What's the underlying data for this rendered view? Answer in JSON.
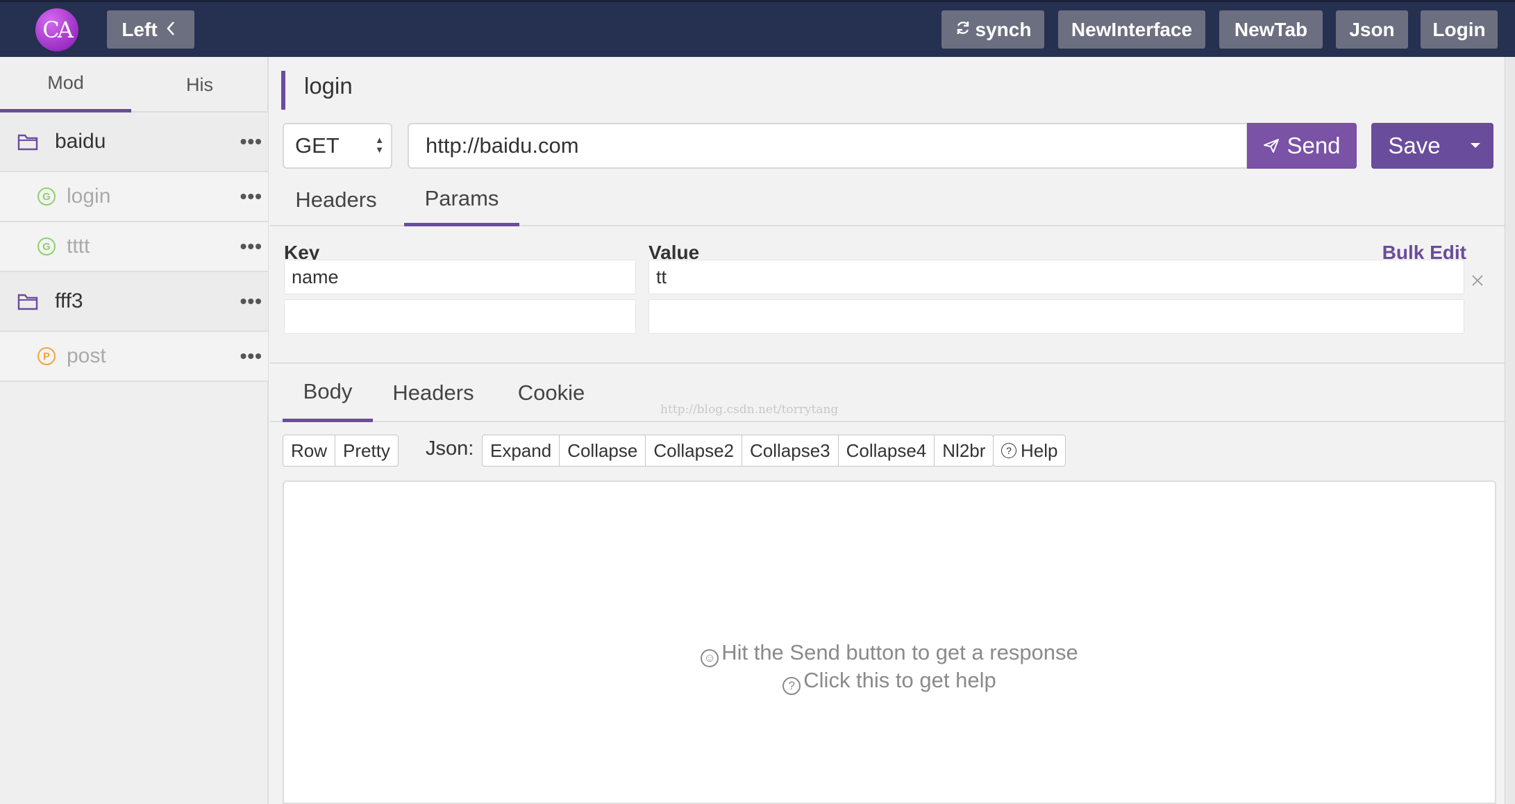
{
  "topbar": {
    "logo_text": "CA",
    "left_button": "Left",
    "buttons": {
      "synch": "synch",
      "new_interface": "NewInterface",
      "new_tab": "NewTab",
      "json": "Json",
      "login": "Login"
    }
  },
  "sidebar": {
    "tabs": [
      "Mod",
      "His"
    ],
    "active_tab": "Mod",
    "tree": {
      "folder1": {
        "name": "baidu"
      },
      "child1": {
        "name": "login",
        "method": "G"
      },
      "child2": {
        "name": "tttt",
        "method": "G"
      },
      "folder2": {
        "name": "fff3"
      },
      "child3": {
        "name": "post",
        "method": "P"
      }
    },
    "more_label": "•••"
  },
  "request": {
    "title": "login",
    "method": "GET",
    "url": "http://baidu.com",
    "send_label": "Send",
    "save_label": "Save",
    "tabs": [
      "Headers",
      "Params"
    ],
    "active_tab": "Params"
  },
  "params": {
    "key_header": "Key",
    "value_header": "Value",
    "bulk_edit": "Bulk Edit",
    "rows": [
      {
        "key": "name",
        "value": "tt"
      },
      {
        "key": "",
        "value": ""
      }
    ]
  },
  "response": {
    "tabs": [
      "Body",
      "Headers",
      "Cookie"
    ],
    "active_tab": "Body",
    "watermark": "http://blog.csdn.net/torrytang",
    "view_modes": [
      "Row",
      "Pretty"
    ],
    "json_label": "Json:",
    "json_actions": [
      "Expand",
      "Collapse",
      "Collapse2",
      "Collapse3",
      "Collapse4",
      "Nl2br"
    ],
    "help_label": "Help",
    "hint_send": "Hit the Send button to get a response",
    "hint_help": "Click this to get help"
  },
  "colors": {
    "topbar": "#263050",
    "accent": "#6a4c9c",
    "send": "#7a52a6",
    "get_badge": "#8fd16b",
    "post_badge": "#f0a63c"
  }
}
